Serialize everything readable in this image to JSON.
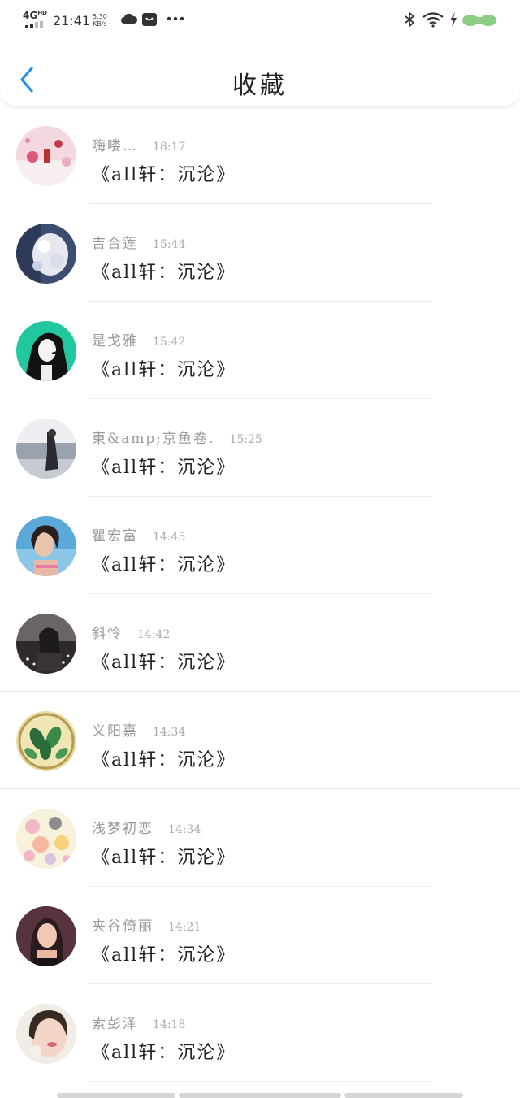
{
  "status_bar": {
    "network": "4G",
    "network_sup": "HD",
    "time": "21:41",
    "speed_value": "5.30",
    "speed_unit": "KB/s",
    "icons": [
      "cloud-icon",
      "mail-bag-icon",
      "more-dots-icon",
      "bluetooth-icon",
      "wifi-icon",
      "charging-icon",
      "battery-icon"
    ],
    "battery_color": "#7ec27a"
  },
  "header": {
    "title": "收藏",
    "back_icon": "chevron-left-icon",
    "accent_color": "#2b8fe6"
  },
  "items": [
    {
      "name": "嗨喽…",
      "time": "18:17",
      "title": "《all轩：沉沦》"
    },
    {
      "name": "吉合莲",
      "time": "15:44",
      "title": "《all轩：沉沦》"
    },
    {
      "name": "是戈雅",
      "time": "15:42",
      "title": "《all轩：沉沦》"
    },
    {
      "name": "東&amp;京鱼卷.",
      "time": "15:25",
      "title": "《all轩：沉沦》"
    },
    {
      "name": "瞿宏富",
      "time": "14:45",
      "title": "《all轩：沉沦》"
    },
    {
      "name": "斜怜",
      "time": "14:42",
      "title": "《all轩：沉沦》"
    },
    {
      "name": "义阳嘉",
      "time": "14:34",
      "title": "《all轩：沉沦》"
    },
    {
      "name": "浅梦初恋",
      "time": "14:34",
      "title": "《all轩：沉沦》"
    },
    {
      "name": "夹谷倚丽",
      "time": "14:21",
      "title": "《all轩：沉沦》"
    },
    {
      "name": "索彭泽",
      "time": "14:18",
      "title": "《all轩：沉沦》"
    }
  ]
}
